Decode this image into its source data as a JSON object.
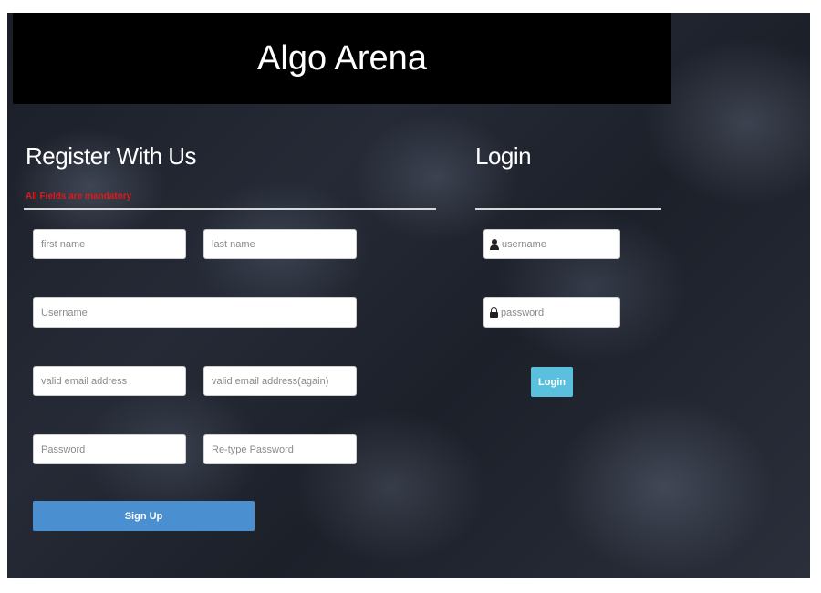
{
  "header": {
    "title": "Algo Arena"
  },
  "register": {
    "title": "Register With Us",
    "mandatory_note": "All Fields are mandatory",
    "fields": {
      "first_name": "first name",
      "last_name": "last name",
      "username": "Username",
      "email": "valid email address",
      "email_again": "valid email address(again)",
      "password": "Password",
      "retype_password": "Re-type Password"
    },
    "signup_label": "Sign Up"
  },
  "login": {
    "title": "Login",
    "username_placeholder": "username",
    "password_placeholder": "password",
    "login_label": "Login",
    "icons": [
      "user-icon",
      "lock-icon"
    ]
  },
  "colors": {
    "header_bg": "#000000",
    "mandatory_text": "#e0191a",
    "signup_button": "#4a8fd0",
    "login_button": "#5bc0de"
  }
}
